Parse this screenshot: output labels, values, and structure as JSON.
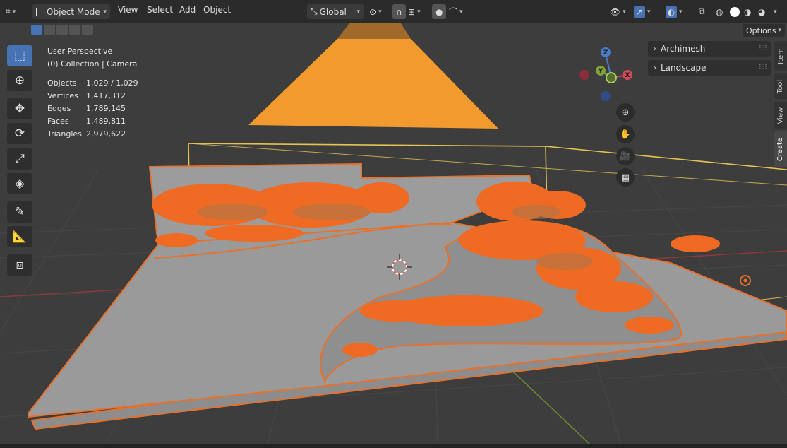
{
  "header": {
    "editor_icon": "editor-type-icon",
    "mode": "Object Mode",
    "menus": [
      "View",
      "Select",
      "Add",
      "Object"
    ],
    "orientation": "Global"
  },
  "viewport": {
    "view_name": "User Perspective",
    "collection": "(0) Collection | Camera",
    "stats": [
      {
        "label": "Objects",
        "value": "1,029 / 1,029"
      },
      {
        "label": "Vertices",
        "value": "1,417,312"
      },
      {
        "label": "Edges",
        "value": "1,789,145"
      },
      {
        "label": "Faces",
        "value": "1,489,811"
      },
      {
        "label": "Triangles",
        "value": "2,979,622"
      }
    ],
    "gizmo": {
      "x": "X",
      "y": "Y",
      "z": "Z"
    }
  },
  "sidebar": {
    "options_label": "Options",
    "panels": [
      "Archimesh",
      "Landscape"
    ],
    "tabs": [
      "Item",
      "Tool",
      "View",
      "Create"
    ]
  },
  "colors": {
    "accent": "#4772b3",
    "selection_outline": "#e8702a",
    "light": "#f29a2e",
    "camera_frame": "#e5c452"
  },
  "tools": [
    "select-box-icon",
    "cursor-icon",
    "move-icon",
    "rotate-icon",
    "scale-icon",
    "transform-icon",
    "annotate-icon",
    "measure-icon",
    "add-cube-icon"
  ]
}
